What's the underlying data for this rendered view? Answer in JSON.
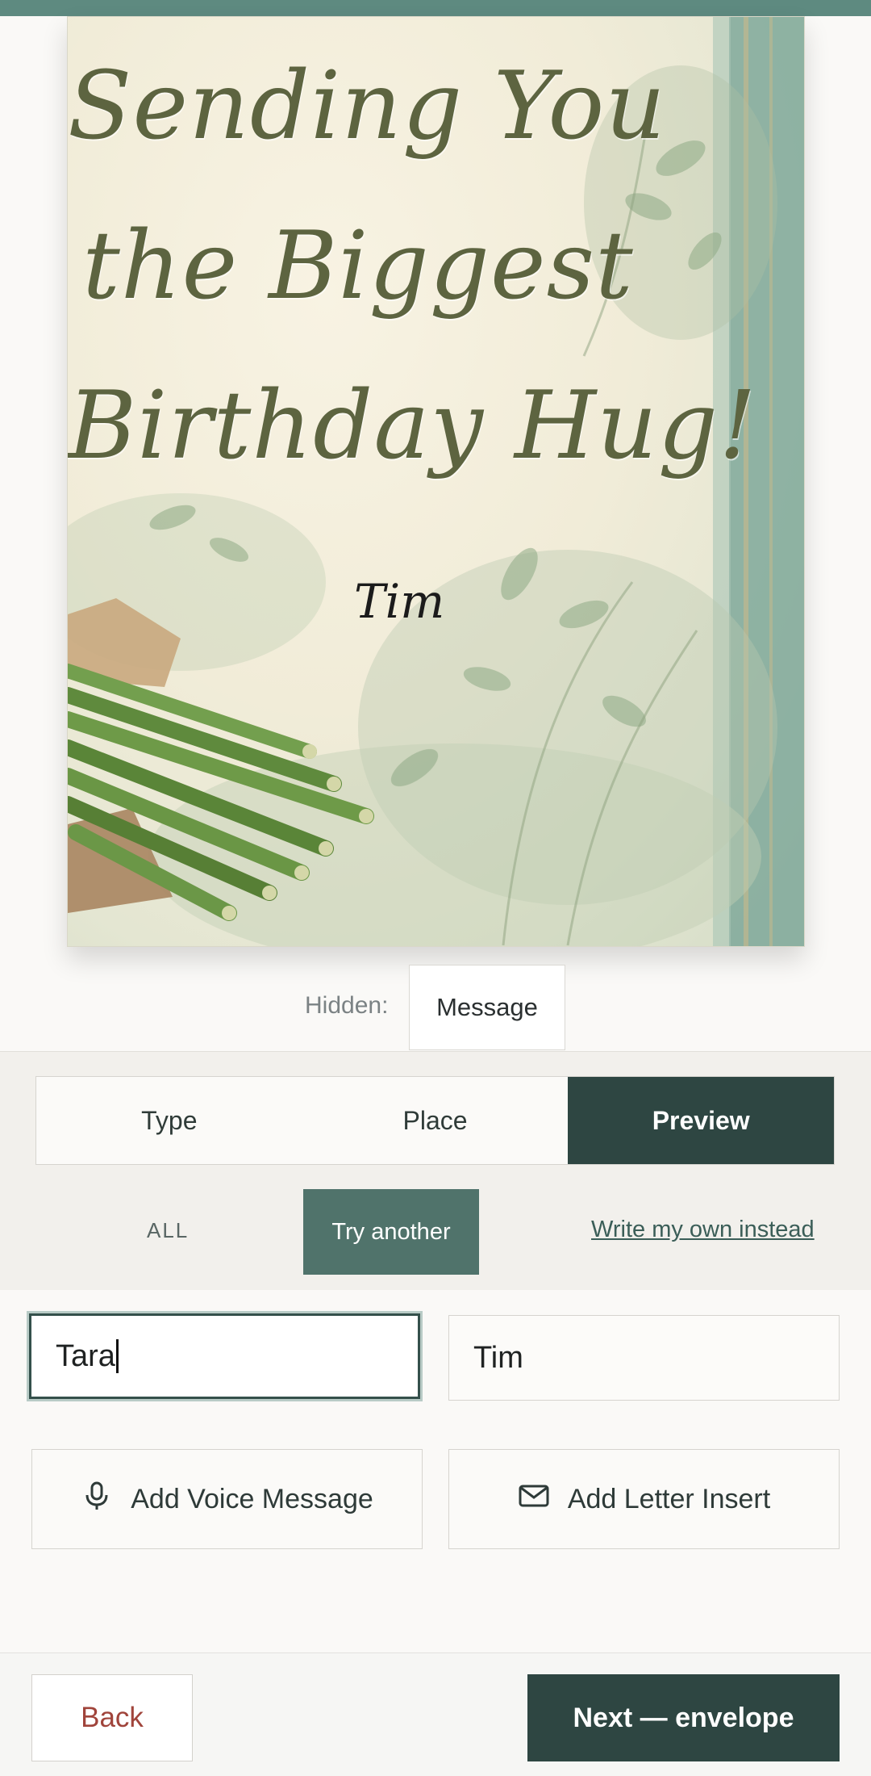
{
  "card": {
    "headline_lines": [
      "Sending You",
      "the Biggest",
      "Birthday Hug!"
    ],
    "signature": "Tim"
  },
  "hidden": {
    "label": "Hidden:",
    "chip": "Message"
  },
  "tabs": [
    {
      "label": "Type",
      "active": false
    },
    {
      "label": "Place",
      "active": false
    },
    {
      "label": "Preview",
      "active": true
    }
  ],
  "suggestions": {
    "all_label": "ALL",
    "try_another": "Try another",
    "write_own": "Write my own instead"
  },
  "fields": {
    "to_value": "Tara",
    "from_value": "Tim"
  },
  "actions": {
    "voice": "Add Voice Message",
    "letter": "Add Letter Insert"
  },
  "footer": {
    "back": "Back",
    "next": "Next — envelope"
  },
  "colors": {
    "accent_dark": "#2e4642",
    "accent_mid": "#50736b",
    "top_strip": "#5e8a80",
    "back_text": "#a0443b"
  },
  "icons": {
    "voice": "microphone-icon",
    "letter": "envelope-icon"
  }
}
